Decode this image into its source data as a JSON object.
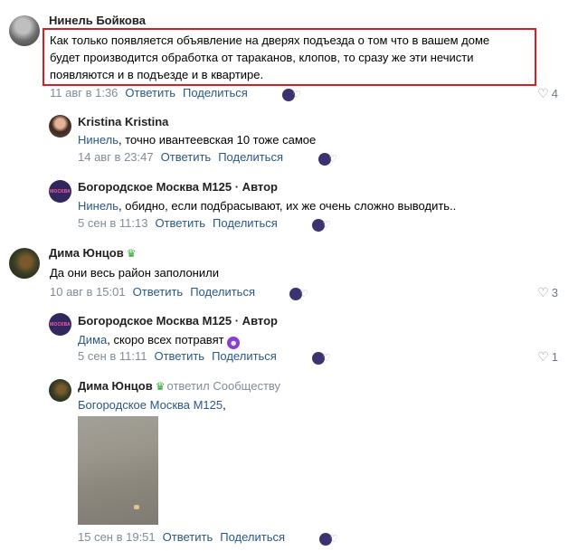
{
  "c1": {
    "author": "Нинель Бойкова",
    "lines": [
      "Как только появляется объявление на дверях подъезда о том что в вашем доме",
      "будет производится обработка от тараканов, клопов, то сразу же эти нечисти",
      "появляются и в подъезде и в квартире."
    ],
    "date": "11 авг в 1:36",
    "reply": "Ответить",
    "share": "Поделиться",
    "likes": "4"
  },
  "c1r1": {
    "author": "Kristina Kristina",
    "mention": "Нинель",
    "text": ", точно ивантеевская 10 тоже самое",
    "date": "14 авг в 23:47",
    "reply": "Ответить",
    "share": "Поделиться"
  },
  "c1r2": {
    "author": "Богородское Москва М125 · Автор",
    "avatar_text": "МОСКВА",
    "mention": "Нинель",
    "text": ", обидно, если подбрасывают, их же очень сложно выводить..",
    "date": "5 сен в 11:13",
    "reply": "Ответить",
    "share": "Поделиться"
  },
  "c2": {
    "author": "Дима Юнцов",
    "crown_icon": "crown-icon",
    "text": "Да они весь район заполонили",
    "date": "10 авг в 15:01",
    "reply": "Ответить",
    "share": "Поделиться",
    "likes": "3"
  },
  "c2r1": {
    "author": "Богородское Москва М125 · Автор",
    "avatar_text": "МОСКВА",
    "mention": "Дима",
    "text": ", скоро всех потравят",
    "date": "5 сен в 11:11",
    "reply": "Ответить",
    "share": "Поделиться",
    "likes": "1"
  },
  "c2r2": {
    "author": "Дима Юнцов",
    "replied": "ответил Сообществу",
    "mention": "Богородское Москва М125",
    "text": ",",
    "date": "15 сен в 19:51",
    "reply": "Ответить",
    "share": "Поделиться"
  },
  "colors": {
    "link": "#2a5885",
    "meta": "#818c99",
    "highlight_border": "#d41f23"
  }
}
